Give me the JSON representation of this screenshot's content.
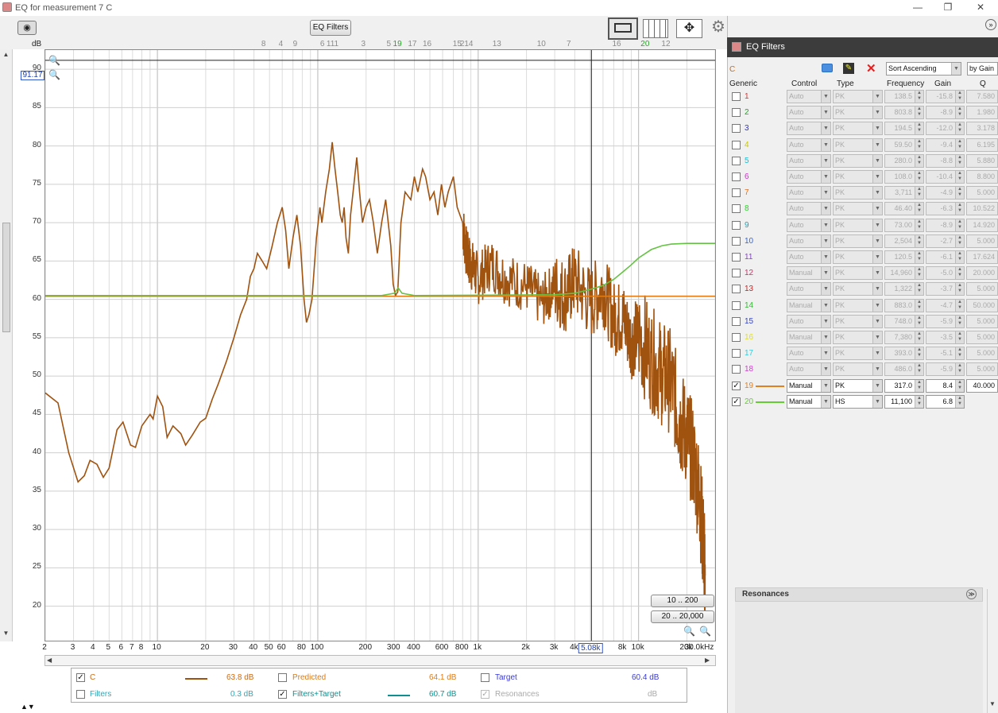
{
  "window": {
    "title": "EQ for measurement 7 C"
  },
  "toolbar": {
    "eq_filters_label": "EQ Filters",
    "cursor_level": "91.17"
  },
  "graph": {
    "y_unit": "dB",
    "y_ticks": [
      "90",
      "85",
      "80",
      "75",
      "70",
      "65",
      "60",
      "55",
      "50",
      "45",
      "40",
      "35",
      "30",
      "25",
      "20"
    ],
    "x_ticks": [
      "2",
      "3",
      "4",
      "5",
      "6",
      "7",
      "8",
      "10",
      "20",
      "30",
      "40",
      "50",
      "60",
      "80",
      "100",
      "200",
      "300",
      "400",
      "600",
      "800",
      "1k",
      "2k",
      "3k",
      "4k",
      "5.08k",
      "8k",
      "10k",
      "20k",
      "30.0kHz"
    ],
    "top_markers": [
      "8",
      "4",
      "9",
      "6",
      "111",
      "3",
      "5",
      "19",
      "17",
      "16",
      "2",
      "15",
      "14",
      "13",
      "10",
      "7",
      "16",
      "20",
      "12"
    ],
    "cursor_freq": "5.08k",
    "range_buttons": [
      "10 .. 200",
      "20 .. 20,000"
    ]
  },
  "chart_data": {
    "type": "line",
    "xscale": "log",
    "xlim": [
      2,
      30000
    ],
    "ylim": [
      15.5,
      92.5
    ],
    "ylabel": "dB",
    "series": [
      {
        "name": "C",
        "color": "#a0520f",
        "points": [
          [
            2,
            47.8
          ],
          [
            2.4,
            46.5
          ],
          [
            2.8,
            40
          ],
          [
            3.2,
            36.2
          ],
          [
            3.5,
            37
          ],
          [
            3.8,
            39
          ],
          [
            4.2,
            38.5
          ],
          [
            4.6,
            36.8
          ],
          [
            5,
            38
          ],
          [
            5.6,
            43
          ],
          [
            6.1,
            44
          ],
          [
            6.8,
            41
          ],
          [
            7.3,
            40.7
          ],
          [
            8,
            43.5
          ],
          [
            9,
            45
          ],
          [
            9.4,
            44.4
          ],
          [
            10,
            47.4
          ],
          [
            10.8,
            46
          ],
          [
            11.5,
            42
          ],
          [
            12.5,
            43.5
          ],
          [
            14,
            42.5
          ],
          [
            15,
            41
          ],
          [
            16.5,
            42.3
          ],
          [
            18.5,
            44
          ],
          [
            20,
            44.5
          ],
          [
            22,
            47
          ],
          [
            24,
            49
          ],
          [
            27,
            52
          ],
          [
            30,
            55
          ],
          [
            33,
            58
          ],
          [
            36,
            60
          ],
          [
            38,
            63
          ],
          [
            40,
            64
          ],
          [
            42,
            66
          ],
          [
            45,
            65
          ],
          [
            48,
            64
          ],
          [
            52,
            67
          ],
          [
            56,
            70
          ],
          [
            60,
            72
          ],
          [
            63,
            69
          ],
          [
            66,
            64
          ],
          [
            70,
            68
          ],
          [
            74,
            71
          ],
          [
            78,
            67
          ],
          [
            82,
            60
          ],
          [
            85,
            57
          ],
          [
            88,
            58
          ],
          [
            92,
            60
          ],
          [
            98,
            68
          ],
          [
            103,
            72
          ],
          [
            106,
            70
          ],
          [
            112,
            74
          ],
          [
            118,
            77
          ],
          [
            123,
            80.5
          ],
          [
            128,
            77
          ],
          [
            133,
            74
          ],
          [
            138,
            71
          ],
          [
            142,
            70
          ],
          [
            146,
            72
          ],
          [
            150,
            68
          ],
          [
            155,
            66
          ],
          [
            160,
            71
          ],
          [
            168,
            75
          ],
          [
            175,
            78.5
          ],
          [
            182,
            74
          ],
          [
            190,
            70
          ],
          [
            200,
            72
          ],
          [
            210,
            73
          ],
          [
            222,
            70
          ],
          [
            235,
            66
          ],
          [
            250,
            70
          ],
          [
            265,
            73
          ],
          [
            285,
            67
          ],
          [
            295,
            62
          ],
          [
            305,
            60.5
          ],
          [
            315,
            61
          ],
          [
            330,
            70
          ],
          [
            350,
            74
          ],
          [
            380,
            73
          ],
          [
            400,
            76
          ],
          [
            420,
            74
          ],
          [
            450,
            77
          ],
          [
            470,
            76
          ],
          [
            500,
            73
          ],
          [
            530,
            74
          ],
          [
            560,
            71
          ],
          [
            590,
            75
          ],
          [
            620,
            72
          ],
          [
            650,
            74
          ],
          [
            700,
            76
          ],
          [
            740,
            72
          ],
          [
            800,
            70
          ],
          [
            850,
            66
          ],
          [
            900,
            65
          ],
          [
            1000,
            63
          ],
          [
            1200,
            65
          ],
          [
            1500,
            63
          ],
          [
            2000,
            62
          ],
          [
            2500,
            60
          ],
          [
            3000,
            62
          ],
          [
            3500,
            61
          ],
          [
            4000,
            63
          ],
          [
            5000,
            60
          ],
          [
            6000,
            62
          ],
          [
            7000,
            58
          ],
          [
            8000,
            58
          ],
          [
            9000,
            55
          ],
          [
            10000,
            56
          ],
          [
            12000,
            53
          ],
          [
            14000,
            51
          ],
          [
            16000,
            50
          ],
          [
            18000,
            45
          ],
          [
            20000,
            43
          ],
          [
            22000,
            40
          ],
          [
            24000,
            35
          ],
          [
            25500,
            28
          ],
          [
            26000,
            24
          ]
        ]
      },
      {
        "name": "Predicted",
        "color": "#e07b16",
        "points": [
          [
            2,
            60.4
          ],
          [
            30000,
            60.4
          ]
        ]
      },
      {
        "name": "Target",
        "color": "#3a3adc",
        "points": []
      },
      {
        "name": "Filters+Target",
        "color": "#66c244",
        "points": [
          [
            2,
            60.5
          ],
          [
            250,
            60.5
          ],
          [
            300,
            60.8
          ],
          [
            317,
            61.5
          ],
          [
            335,
            60.8
          ],
          [
            400,
            60.5
          ],
          [
            3000,
            60.6
          ],
          [
            4000,
            60.8
          ],
          [
            5000,
            61.3
          ],
          [
            6000,
            61.8
          ],
          [
            7000,
            62.6
          ],
          [
            8000,
            63.6
          ],
          [
            9000,
            64.5
          ],
          [
            10000,
            65.4
          ],
          [
            12000,
            66.5
          ],
          [
            14000,
            67
          ],
          [
            16000,
            67.2
          ],
          [
            20000,
            67.3
          ],
          [
            30000,
            67.3
          ]
        ]
      }
    ]
  },
  "legend": {
    "row1": [
      {
        "label": "C",
        "checked": true,
        "color": "#d06a10",
        "value": "63.8 dB"
      },
      {
        "label": "Predicted",
        "checked": false,
        "color": "#e07b16",
        "value": "64.1 dB"
      },
      {
        "label": "Target",
        "checked": false,
        "color": "#3a3adc",
        "value": "60.4 dB"
      }
    ],
    "row2": [
      {
        "label": "Filters",
        "checked": false,
        "color": "#31a6b6",
        "value": "0.3 dB"
      },
      {
        "label": "Filters+Target",
        "checked": true,
        "color": "#0f8f8f",
        "value": "60.7 dB"
      },
      {
        "label": "Resonances",
        "checked": true,
        "color": "#aaaaaa",
        "value": "dB"
      }
    ]
  },
  "eq": {
    "title": "EQ Filters",
    "channel": "C",
    "sort": "Sort Ascending",
    "by": "by Gain",
    "headers": {
      "generic": "Generic",
      "control": "Control",
      "type": "Type",
      "frequency": "Frequency",
      "gain": "Gain",
      "q": "Q"
    },
    "filters": [
      {
        "n": "1",
        "color": "#e03333",
        "control": "Auto",
        "type": "PK",
        "freq": "138.5",
        "gain": "-15.8",
        "q": "7.580",
        "checked": false
      },
      {
        "n": "2",
        "color": "#2a9a2a",
        "control": "Auto",
        "type": "PK",
        "freq": "803.8",
        "gain": "-8.9",
        "q": "1.980",
        "checked": false
      },
      {
        "n": "3",
        "color": "#3333cc",
        "control": "Auto",
        "type": "PK",
        "freq": "194.5",
        "gain": "-12.0",
        "q": "3.178",
        "checked": false
      },
      {
        "n": "4",
        "color": "#c8c800",
        "control": "Auto",
        "type": "PK",
        "freq": "59.50",
        "gain": "-9.4",
        "q": "6.195",
        "checked": false
      },
      {
        "n": "5",
        "color": "#22bbcc",
        "control": "Auto",
        "type": "PK",
        "freq": "280.0",
        "gain": "-8.8",
        "q": "5.880",
        "checked": false
      },
      {
        "n": "6",
        "color": "#cc33cc",
        "control": "Auto",
        "type": "PK",
        "freq": "108.0",
        "gain": "-10.4",
        "q": "8.800",
        "checked": false
      },
      {
        "n": "7",
        "color": "#e07020",
        "control": "Auto",
        "type": "PK",
        "freq": "3,711",
        "gain": "-4.9",
        "q": "5.000",
        "checked": false
      },
      {
        "n": "8",
        "color": "#33cc33",
        "control": "Auto",
        "type": "PK",
        "freq": "46.40",
        "gain": "-6.3",
        "q": "10.522",
        "checked": false
      },
      {
        "n": "9",
        "color": "#2a9aaa",
        "control": "Auto",
        "type": "PK",
        "freq": "73.00",
        "gain": "-8.9",
        "q": "14.920",
        "checked": false
      },
      {
        "n": "10",
        "color": "#3366dd",
        "control": "Auto",
        "type": "PK",
        "freq": "2,504",
        "gain": "-2.7",
        "q": "5.000",
        "checked": false
      },
      {
        "n": "11",
        "color": "#8844cc",
        "control": "Auto",
        "type": "PK",
        "freq": "120.5",
        "gain": "-6.1",
        "q": "17.624",
        "checked": false
      },
      {
        "n": "12",
        "color": "#cc3366",
        "control": "Manual",
        "type": "PK",
        "freq": "14,960",
        "gain": "-5.0",
        "q": "20.000",
        "checked": false
      },
      {
        "n": "13",
        "color": "#cc2222",
        "control": "Auto",
        "type": "PK",
        "freq": "1,322",
        "gain": "-3.7",
        "q": "5.000",
        "checked": false
      },
      {
        "n": "14",
        "color": "#33bb33",
        "control": "Manual",
        "type": "PK",
        "freq": "883.0",
        "gain": "-4.7",
        "q": "50.000",
        "checked": false
      },
      {
        "n": "15",
        "color": "#3344cc",
        "control": "Auto",
        "type": "PK",
        "freq": "748.0",
        "gain": "-5.9",
        "q": "5.000",
        "checked": false
      },
      {
        "n": "16",
        "color": "#dddd33",
        "control": "Manual",
        "type": "PK",
        "freq": "7,380",
        "gain": "-3.5",
        "q": "5.000",
        "checked": false
      },
      {
        "n": "17",
        "color": "#33ccdd",
        "control": "Auto",
        "type": "PK",
        "freq": "393.0",
        "gain": "-5.1",
        "q": "5.000",
        "checked": false
      },
      {
        "n": "18",
        "color": "#cc44cc",
        "control": "Auto",
        "type": "PK",
        "freq": "486.0",
        "gain": "-5.9",
        "q": "5.000",
        "checked": false
      },
      {
        "n": "19",
        "color": "#e08020",
        "control": "Manual",
        "type": "PK",
        "freq": "317.0",
        "gain": "8.4",
        "q": "40.000",
        "checked": true
      },
      {
        "n": "20",
        "color": "#66cc33",
        "control": "Manual",
        "type": "HS",
        "freq": "11,100",
        "gain": "6.8",
        "q": "",
        "checked": true
      }
    ],
    "resonances_label": "Resonances"
  }
}
